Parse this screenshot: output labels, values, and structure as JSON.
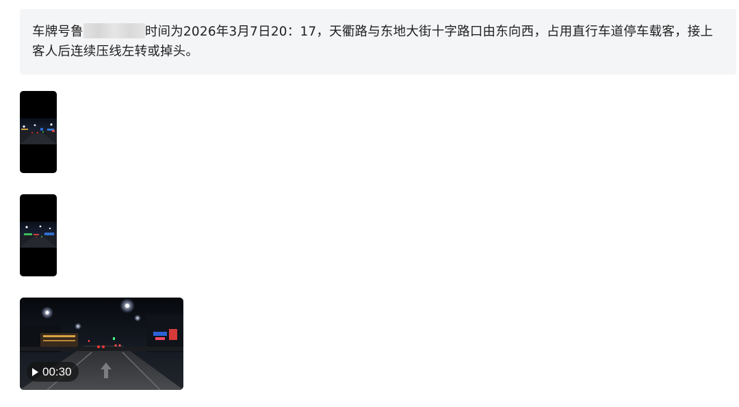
{
  "message": {
    "text_before": "车牌号鲁",
    "text_after": "时间为2026年3月7日20：17，天衢路与东地大街十字路口由东向西，占用直行车道停车载客，接上客人后连续压线左转或掉头。"
  },
  "attachments": [
    {
      "kind": "image",
      "description": "night-street-photo-1"
    },
    {
      "kind": "image",
      "description": "night-street-photo-2"
    },
    {
      "kind": "video",
      "duration": "00:30"
    }
  ]
}
